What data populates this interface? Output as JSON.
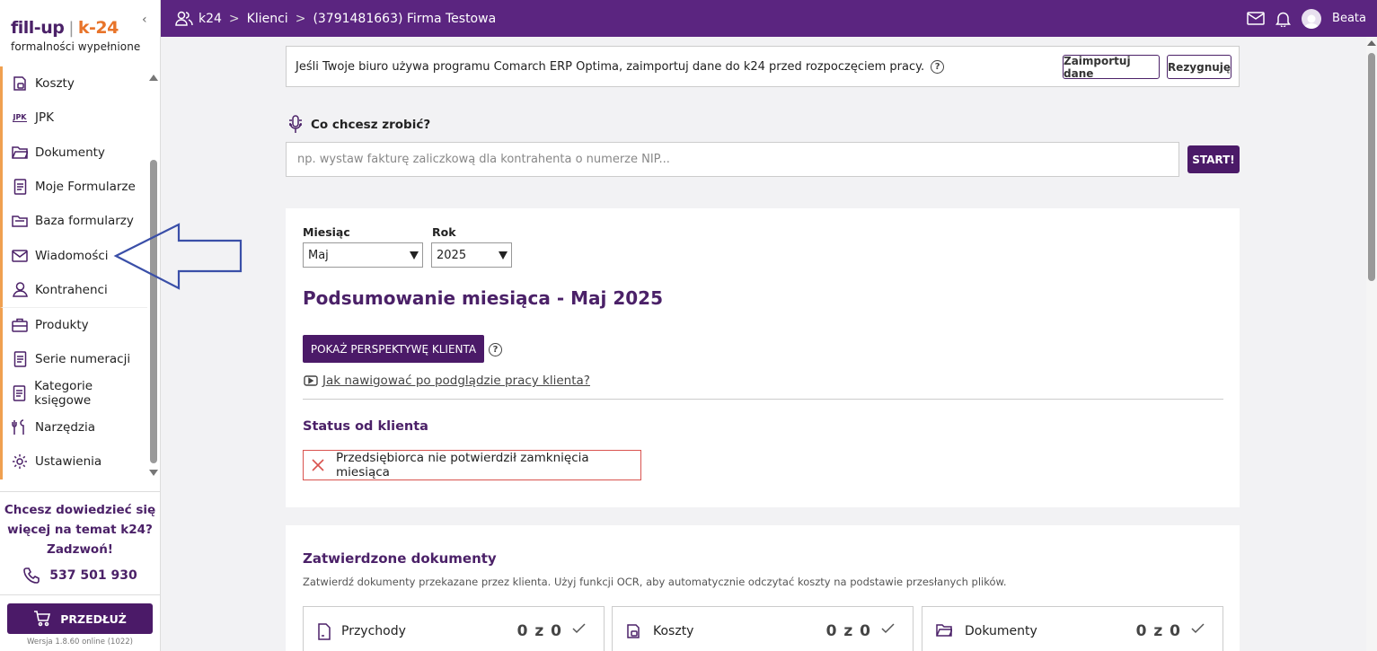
{
  "logo": {
    "fill": "fill-up",
    "k24": "k-24",
    "tagline": "formalności wypełnione"
  },
  "sidebar": {
    "items": [
      {
        "label": "Koszty",
        "icon": "receipt-icon"
      },
      {
        "label": "JPK",
        "icon": "jpk-icon",
        "icon_text": "JPK"
      },
      {
        "label": "Dokumenty",
        "icon": "folder-icon"
      },
      {
        "label": "Moje Formularze",
        "icon": "document-icon"
      },
      {
        "label": "Baza formularzy",
        "icon": "folder-stack-icon"
      },
      {
        "label": "Wiadomości",
        "icon": "mail-icon"
      },
      {
        "label": "Kontrahenci",
        "icon": "user-icon"
      },
      {
        "label": "Produkty",
        "icon": "briefcase-icon"
      },
      {
        "label": "Serie numeracji",
        "icon": "document-icon"
      },
      {
        "label": "Kategorie księgowe",
        "icon": "document-icon"
      },
      {
        "label": "Narzędzia",
        "icon": "tools-icon"
      },
      {
        "label": "Ustawienia",
        "icon": "gear-icon"
      }
    ],
    "promo_line1": "Chcesz dowiedzieć się",
    "promo_line2": "więcej na temat k24?",
    "promo_line3": "Zadzwoń!",
    "phone": "537 501 930",
    "extend_label": "PRZEDŁUŻ",
    "version": "Wersja 1.8.60 online (1022)"
  },
  "topbar": {
    "crumbs": [
      "k24",
      "Klienci",
      "(3791481663) Firma Testowa"
    ],
    "user": "Beata"
  },
  "banner": {
    "text": "Jeśli Twoje biuro używa programu Comarch ERP Optima, zaimportuj dane do k24 przed rozpoczęciem pracy.",
    "help": "?",
    "import_label": "Zaimportuj dane",
    "decline_label": "Rezygnuję"
  },
  "ask": {
    "label": "Co chcesz zrobić?",
    "placeholder": "np. wystaw fakturę zaliczkową dla kontrahenta o numerze NIP...",
    "start_label": "START!"
  },
  "summary": {
    "month_label": "Miesiąc",
    "month_value": "Maj",
    "year_label": "Rok",
    "year_value": "2025",
    "title": "Podsumowanie miesiąca - Maj 2025",
    "perspective_label": "POKAŻ PERSPEKTYWĘ KLIENTA",
    "help": "?",
    "howto_link": "Jak nawigować po podglądzie pracy klienta?",
    "status_title": "Status od klienta",
    "status_text": "Przedsiębiorca nie potwierdził zamknięcia miesiąca"
  },
  "documents": {
    "title": "Zatwierdzone dokumenty",
    "description": "Zatwierdź dokumenty przekazane przez klienta. Użyj funkcji OCR, aby automatycznie odczytać koszty na podstawie przesłanych plików.",
    "tiles": [
      {
        "label": "Przychody",
        "count": "0 z 0"
      },
      {
        "label": "Koszty",
        "count": "0 z 0"
      },
      {
        "label": "Dokumenty",
        "count": "0 z 0"
      }
    ]
  },
  "colors": {
    "brand": "#5b2580",
    "button": "#4b1a68",
    "accent": "#f0a050",
    "error": "#d9534f",
    "annotation": "#3a4fa8"
  }
}
